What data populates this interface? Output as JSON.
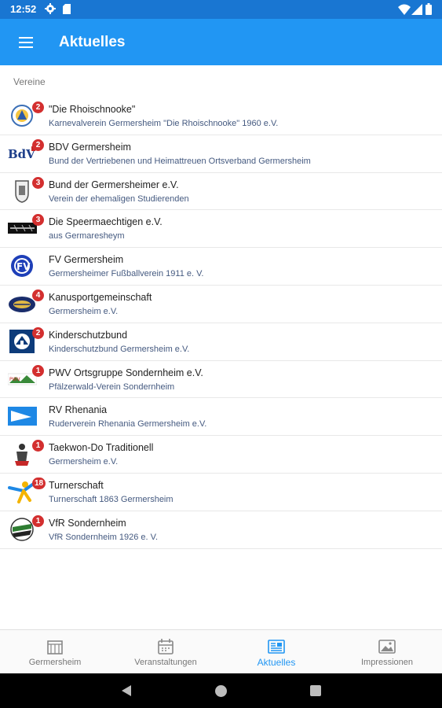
{
  "status_bar": {
    "time": "12:52",
    "icons": [
      "gear-icon",
      "sd-card-icon",
      "wifi-icon",
      "signal-icon",
      "battery-icon"
    ]
  },
  "app_bar": {
    "title": "Aktuelles",
    "menu_icon": "hamburger-menu-icon",
    "color": "#2196f3"
  },
  "section": {
    "title": "Vereine"
  },
  "clubs": [
    {
      "name": "\"Die Rhoischnooke\"",
      "subtitle": "Karnevalverein Germersheim \"Die Rhoischnooke\" 1960 e.V.",
      "badge": "2",
      "logo": "rhoischnooke-logo"
    },
    {
      "name": "BDV Germersheim",
      "subtitle": "Bund der Vertriebenen und Heimattreuen Ortsverband Germersheim",
      "badge": "2",
      "logo": "bdv-logo"
    },
    {
      "name": "Bund der Germersheimer e.V.",
      "subtitle": "Verein der ehemaligen Studierenden",
      "badge": "3",
      "logo": "bund-germersheimer-logo"
    },
    {
      "name": "Die Speermaechtigen e.V.",
      "subtitle": "aus Germaresheym",
      "badge": "3",
      "logo": "speermaechtigen-logo"
    },
    {
      "name": "FV Germersheim",
      "subtitle": "Germersheimer Fußballverein 1911 e. V.",
      "badge": "",
      "logo": "fv-germersheim-logo"
    },
    {
      "name": "Kanusportgemeinschaft",
      "subtitle": "Germersheim e.V.",
      "badge": "4",
      "logo": "kanusport-logo"
    },
    {
      "name": "Kinderschutzbund",
      "subtitle": "Kinderschutzbund Germersheim e.V.",
      "badge": "2",
      "logo": "kinderschutzbund-logo"
    },
    {
      "name": "PWV Ortsgruppe Sondernheim e.V.",
      "subtitle": "Pfälzerwald-Verein Sondernheim",
      "badge": "1",
      "logo": "pwv-logo"
    },
    {
      "name": "RV Rhenania",
      "subtitle": "Ruderverein Rhenania Germersheim e.V.",
      "badge": "",
      "logo": "rv-rhenania-logo"
    },
    {
      "name": "Taekwon-Do Traditionell",
      "subtitle": "Germersheim e.V.",
      "badge": "1",
      "logo": "taekwondo-logo"
    },
    {
      "name": "Turnerschaft",
      "subtitle": "Turnerschaft 1863 Germersheim",
      "badge": "18",
      "logo": "turnerschaft-logo"
    },
    {
      "name": "VfR Sondernheim",
      "subtitle": "VfR Sondernheim 1926 e. V.",
      "badge": "1",
      "logo": "vfr-sondernheim-logo"
    }
  ],
  "bottom_nav": {
    "items": [
      {
        "label": "Germersheim",
        "icon": "city-icon",
        "active": false
      },
      {
        "label": "Veranstaltungen",
        "icon": "calendar-icon",
        "active": false
      },
      {
        "label": "Aktuelles",
        "icon": "news-icon",
        "active": true
      },
      {
        "label": "Impressionen",
        "icon": "image-icon",
        "active": false
      }
    ],
    "active_color": "#2196f3"
  },
  "system_nav": {
    "icons": [
      "back-icon",
      "home-icon",
      "recents-icon"
    ]
  }
}
